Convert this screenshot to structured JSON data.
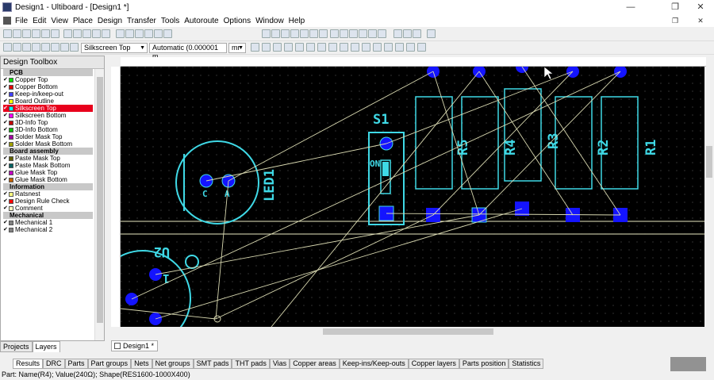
{
  "window": {
    "title": "Design1 - Ultiboard - [Design1 *]",
    "minimize": "—",
    "restore": "❐",
    "close": "✕"
  },
  "menu": [
    "File",
    "Edit",
    "View",
    "Place",
    "Design",
    "Transfer",
    "Tools",
    "Autoroute",
    "Options",
    "Window",
    "Help"
  ],
  "toolbar2": {
    "layer_select": "Silkscreen Top",
    "grid_select": "Automatic (0.000001 m",
    "unit_select": "mr"
  },
  "toolbox": {
    "title": "Design Toolbox",
    "sections": [
      {
        "label": "PCB",
        "items": [
          {
            "label": "Copper Top",
            "color": "#00e000",
            "checked": true
          },
          {
            "label": "Copper Bottom",
            "color": "#e00000",
            "checked": true
          },
          {
            "label": "Keep-in/keep-out",
            "color": "#4040ff",
            "checked": true
          },
          {
            "label": "Board Outline",
            "color": "#ffff00",
            "checked": true
          },
          {
            "label": "Silkscreen Top",
            "color": "#00ffff",
            "checked": true,
            "selected": true
          },
          {
            "label": "Silkscreen Bottom",
            "color": "#ff00ff",
            "checked": true
          },
          {
            "label": "3D-Info Top",
            "color": "#c00000",
            "checked": true
          },
          {
            "label": "3D-Info Bottom",
            "color": "#00c000",
            "checked": true
          },
          {
            "label": "Solder Mask Top",
            "color": "#a000a0",
            "checked": true
          },
          {
            "label": "Solder Mask Bottom",
            "color": "#a0a000",
            "checked": true
          }
        ]
      },
      {
        "label": "Board assembly",
        "items": [
          {
            "label": "Paste Mask Top",
            "color": "#606000",
            "checked": true
          },
          {
            "label": "Paste Mask Bottom",
            "color": "#006060",
            "checked": true
          },
          {
            "label": "Glue Mask Top",
            "color": "#c000c0",
            "checked": true
          },
          {
            "label": "Glue Mask Bottom",
            "color": "#c06000",
            "checked": true
          }
        ]
      },
      {
        "label": "Information",
        "items": [
          {
            "label": "Ratsnest",
            "color": "#ffff80",
            "checked": true
          },
          {
            "label": "Design Rule Check",
            "color": "#ff0000",
            "checked": true
          },
          {
            "label": "Comment",
            "color": "#ffffc0",
            "checked": true
          }
        ]
      },
      {
        "label": "Mechanical",
        "items": [
          {
            "label": "Mechanical 1",
            "color": "#808080",
            "checked": true
          },
          {
            "label": "Mechanical 2",
            "color": "#808080",
            "checked": true
          }
        ]
      }
    ],
    "tabs": [
      "Projects",
      "Layers"
    ]
  },
  "canvas": {
    "parts": [
      "S1",
      "R5",
      "R4",
      "R3",
      "R2",
      "R1",
      "LED1",
      "U2"
    ],
    "pad_labels": {
      "led_c": "C",
      "led_a": "A",
      "switch_on": "ON",
      "u2_pin": "1"
    },
    "colors": {
      "background": "#000000",
      "silkscreen": "#3fd9e6",
      "pad": "#1414ff",
      "ratsnest": "#d8d8b0",
      "outline": "#ffffb0"
    }
  },
  "doc_tab": "Design1 *",
  "bottom_tabs": [
    "Results",
    "DRC",
    "Parts",
    "Part groups",
    "Nets",
    "Net groups",
    "SMT pads",
    "THT pads",
    "Vias",
    "Copper areas",
    "Keep-ins/Keep-outs",
    "Copper layers",
    "Parts position",
    "Statistics"
  ],
  "status": "Part: Name(R4); Value(240Ω); Shape(RES1600-1000X400)"
}
